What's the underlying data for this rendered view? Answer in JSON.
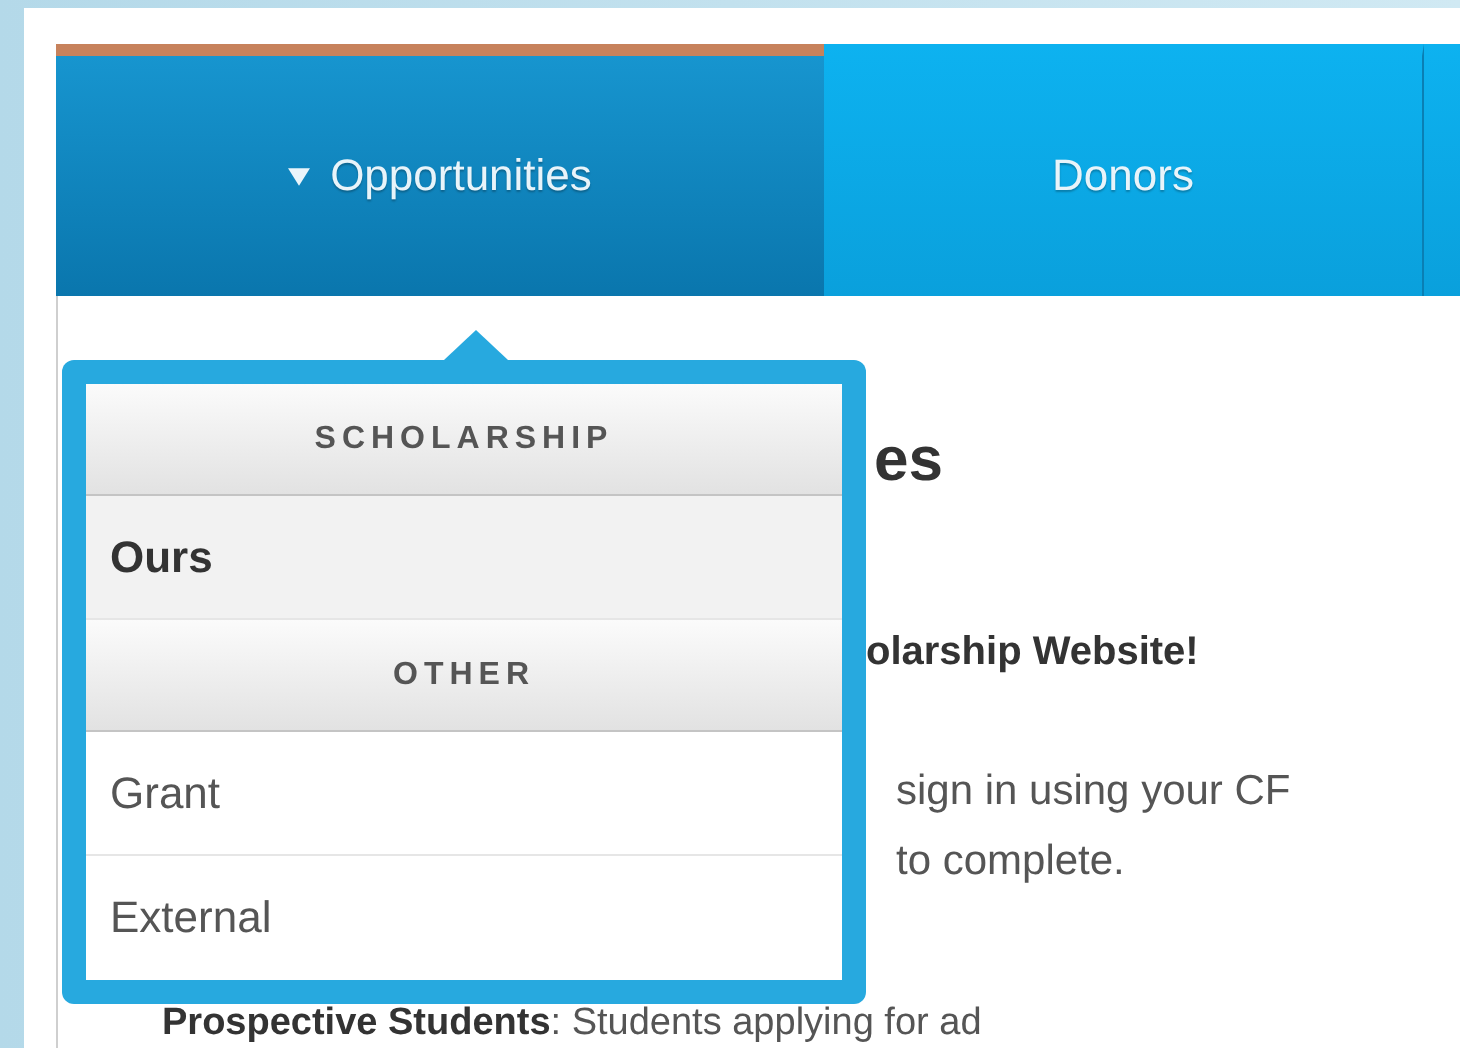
{
  "nav": {
    "tabs": [
      {
        "label": "Opportunities",
        "selected": true,
        "expanded": true
      },
      {
        "label": "Donors",
        "selected": false,
        "expanded": false
      }
    ]
  },
  "dropdown": {
    "entries": [
      {
        "kind": "header",
        "label": "SCHOLARSHIP"
      },
      {
        "kind": "item",
        "label": "Ours",
        "selected": true
      },
      {
        "kind": "header",
        "label": "OTHER"
      },
      {
        "kind": "item",
        "label": "Grant",
        "selected": false
      },
      {
        "kind": "item",
        "label": "External",
        "selected": false
      }
    ]
  },
  "content": {
    "heading": "es",
    "subheading": "olarship Website!",
    "lines": [
      "sign in using your CF",
      "to complete."
    ],
    "note": "**Prospective Students**: Students applying for ad"
  }
}
